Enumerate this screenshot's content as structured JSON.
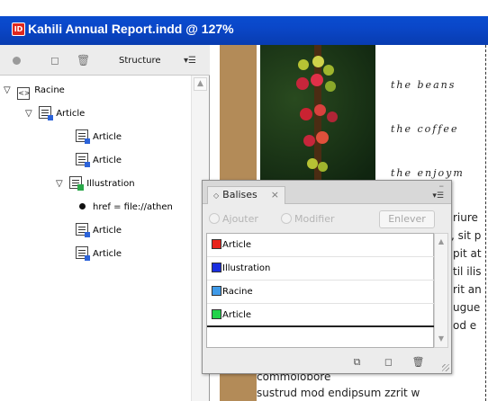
{
  "window": {
    "app_badge": "ID",
    "title": "Kahili Annual Report.indd @ 127%"
  },
  "structure_panel": {
    "label": "Structure",
    "tree": [
      {
        "label": "Racine",
        "icon": "tag-bracket-icon",
        "expanded": true
      },
      {
        "label": "Article",
        "icon": "article-doc-icon",
        "expanded": true
      },
      {
        "label": "Article",
        "icon": "article-doc-icon"
      },
      {
        "label": "Article",
        "icon": "article-doc-icon"
      },
      {
        "label": "Illustration",
        "icon": "image-doc-icon",
        "expanded": true
      },
      {
        "label": "href = file://athen",
        "icon": "bullet-icon"
      },
      {
        "label": "Article",
        "icon": "article-doc-icon"
      },
      {
        "label": "Article",
        "icon": "article-doc-icon"
      }
    ]
  },
  "document": {
    "script_lines": [
      "the beans",
      "the coffee",
      "the enjoym"
    ],
    "body_fragments": [
      "riure",
      ", sit p",
      "pit at",
      "til ilis",
      "rit an",
      "ugue",
      "od e",
      "commolobore",
      "sustrud mod endipsum zzrit w"
    ]
  },
  "balises_panel": {
    "tab_label": "Balises",
    "radio_add": "Ajouter",
    "radio_modify": "Modifier",
    "remove_button": "Enlever",
    "tags": [
      {
        "label": "Article",
        "color": "#e8241c"
      },
      {
        "label": "Illustration",
        "color": "#1a2ee0"
      },
      {
        "label": "Racine",
        "color": "#3f9ae8"
      },
      {
        "label": "Article",
        "color": "#22d24a"
      }
    ]
  }
}
